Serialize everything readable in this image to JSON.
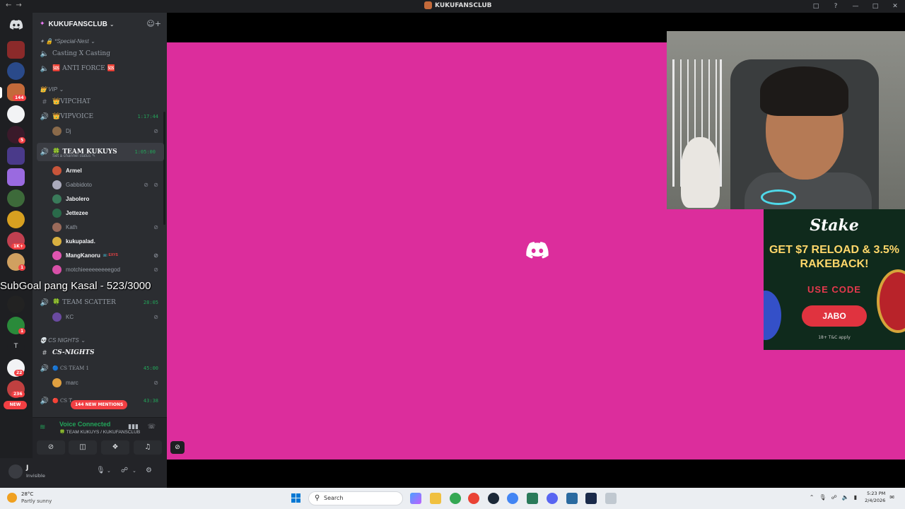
{
  "window": {
    "title": "KUKUFANSCLUB"
  },
  "server": {
    "name": "KUKUFANSCLUB"
  },
  "rail": {
    "new_label": "NEW",
    "badges": [
      "144",
      "5",
      "1K+",
      "1",
      "1",
      "22",
      "236"
    ],
    "letter": "T"
  },
  "channels": {
    "special_nest": "✦ 🔒 *Special-Nest",
    "casting": "Casting X Casting",
    "anti_force": "🆘 ANTI FORCE 🆘",
    "vip_cat": "👑 VIP",
    "vipchat": "👑VIPCHAT",
    "vipvoice": "👑VIPVOICE",
    "vipvoice_time": "1:17:44",
    "team_kukuys": "🍀 TEAM KUKUYS",
    "team_kukuys_time": "1:05:00",
    "channel_status": "Set a channel status ✎",
    "team_scatter": "🍀 TEAM SCATTER",
    "team_scatter_time": "28:05",
    "cs_nights_cat": "💀 CS NIGHTS",
    "cs_nights": "CS-NIGHTS",
    "cs_team1": "🔵 CS TEAM 1",
    "cs_team1_time": "45:00",
    "cs_team2": "🔴 CS T",
    "cs_team2_time": "43:38"
  },
  "users": {
    "dj": "Dj",
    "armel": "Armel",
    "gabbidoto": "Gabbidoto",
    "jabolero": "Jabolero",
    "jettezee": "Jettezee",
    "kath": "Kath",
    "kukupalad": "kukupalad.",
    "mangkanoru": "MangKanoru",
    "mangkanoru_tag": "📺 EXYS",
    "motchi": "motchieeeeeeeeegod",
    "kc": "KC",
    "marc": "marc"
  },
  "mentions": "144 NEW MENTIONS",
  "voice": {
    "status": "Voice Connected",
    "location": "🍀 TEAM KUKUYS / KUKUFANSCLUB"
  },
  "me": {
    "name": "J",
    "status": "Invisible"
  },
  "overlay": {
    "subgoal": "SubGoal pang Kasal - 523/3000"
  },
  "ad": {
    "brand": "Stake",
    "headline": "GET $7 RELOAD & 3.5% RAKEBACK!",
    "code_label": "USE CODE",
    "code": "JABO",
    "terms": "18+  T&C apply"
  },
  "taskbar": {
    "temp": "28°C",
    "condition": "Partly sunny",
    "search_placeholder": "Search",
    "time": "5:23 PM",
    "date": "2/4/2026"
  },
  "colors": {
    "stream_bg": "#dc2d9c",
    "sidebar": "#2b2d31",
    "rail": "#1e1f22",
    "voice_green": "#23a55a",
    "mention_red": "#f23f43"
  }
}
